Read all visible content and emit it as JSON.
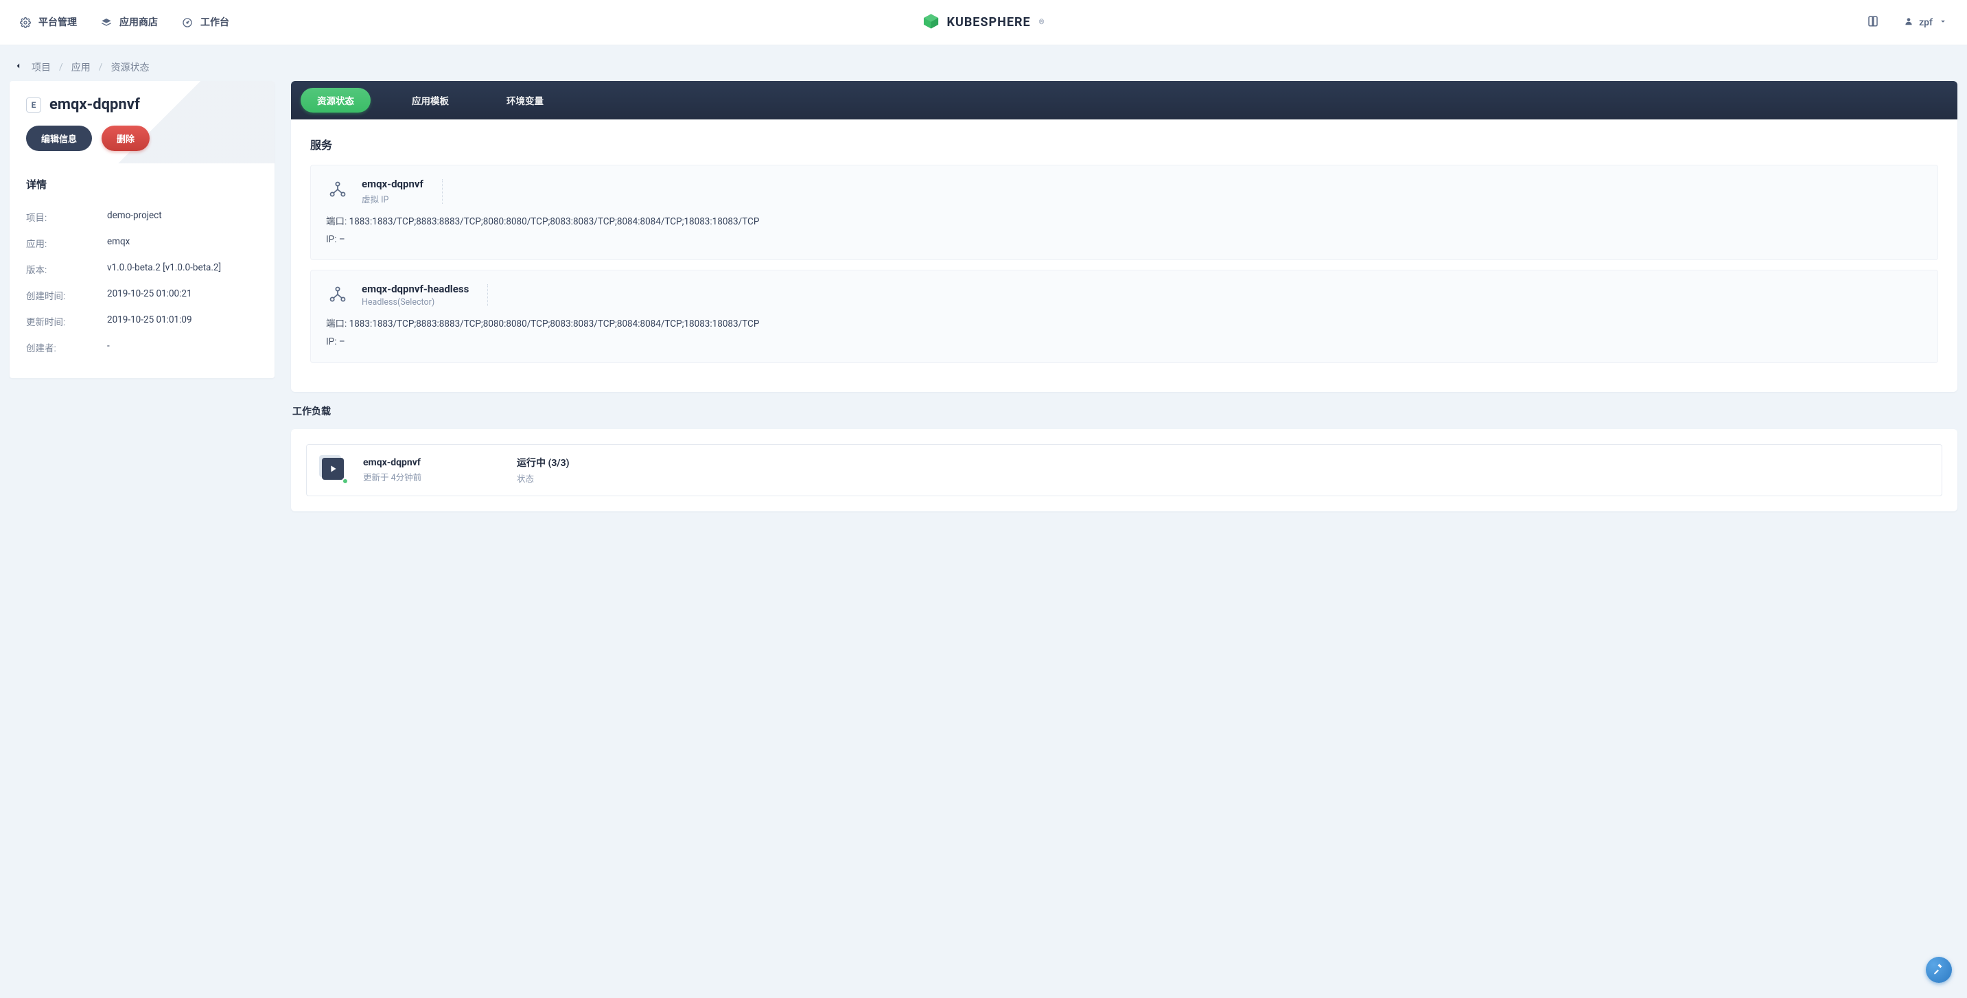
{
  "topbar": {
    "items": [
      {
        "label": "平台管理"
      },
      {
        "label": "应用商店"
      },
      {
        "label": "工作台"
      }
    ],
    "logo_text": "KUBESPHERE",
    "user_name": "zpf"
  },
  "breadcrumb": {
    "items": [
      "项目",
      "应用",
      "资源状态"
    ]
  },
  "resource": {
    "badge_letter": "E",
    "name": "emqx-dqpnvf",
    "actions": {
      "edit_label": "编辑信息",
      "delete_label": "删除"
    }
  },
  "details": {
    "heading": "详情",
    "rows": [
      {
        "k": "项目:",
        "v": "demo-project"
      },
      {
        "k": "应用:",
        "v": "emqx"
      },
      {
        "k": "版本:",
        "v": "v1.0.0-beta.2 [v1.0.0-beta.2]"
      },
      {
        "k": "创建时间:",
        "v": "2019-10-25 01:00:21"
      },
      {
        "k": "更新时间:",
        "v": "2019-10-25 01:01:09"
      },
      {
        "k": "创建者:",
        "v": "-"
      }
    ]
  },
  "tabs": {
    "items": [
      {
        "label": "资源状态",
        "active": true
      },
      {
        "label": "应用模板",
        "active": false
      },
      {
        "label": "环境变量",
        "active": false
      }
    ]
  },
  "services": {
    "heading": "服务",
    "port_label": "端口: ",
    "ip_label": "IP: ",
    "items": [
      {
        "name": "emqx-dqpnvf",
        "subtitle": "虚拟 IP",
        "ports": "1883:1883/TCP;8883:8883/TCP;8080:8080/TCP;8083:8083/TCP;8084:8084/TCP;18083:18083/TCP",
        "ip": "–"
      },
      {
        "name": "emqx-dqpnvf-headless",
        "subtitle": "Headless(Selector)",
        "ports": "1883:1883/TCP;8883:8883/TCP;8080:8080/TCP;8083:8083/TCP;8084:8084/TCP;18083:18083/TCP",
        "ip": "–"
      }
    ]
  },
  "workloads": {
    "heading": "工作负载",
    "items": [
      {
        "name": "emqx-dqpnvf",
        "updated": "更新于 4分钟前",
        "state": "运行中 (3/3)",
        "state_sub": "状态"
      }
    ]
  }
}
